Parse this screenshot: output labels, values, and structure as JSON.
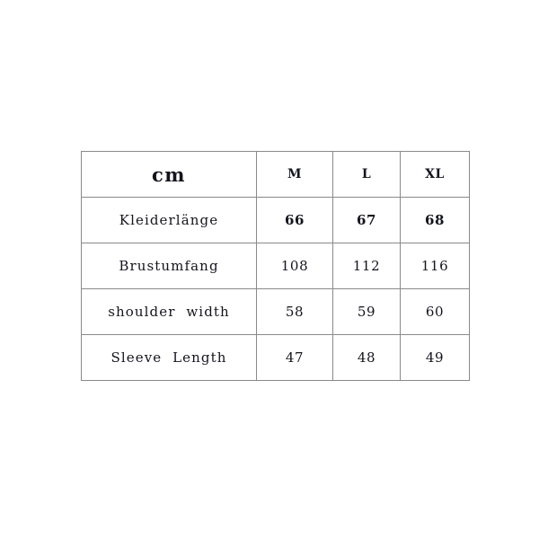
{
  "table": {
    "header": {
      "unit_label": "cm",
      "sizes": [
        "M",
        "L",
        "XL"
      ]
    },
    "rows": [
      {
        "label": "Kleiderlänge",
        "bold_values": true,
        "values": [
          "66",
          "67",
          "68"
        ]
      },
      {
        "label": "Brustumfang",
        "bold_values": false,
        "values": [
          "108",
          "112",
          "116"
        ]
      },
      {
        "label": "shoulder width",
        "bold_values": false,
        "values": [
          "58",
          "59",
          "60"
        ]
      },
      {
        "label": "Sleeve Length",
        "bold_values": false,
        "values": [
          "47",
          "48",
          "49"
        ]
      }
    ]
  },
  "colors": {
    "background": "#ffffff",
    "border": "#8a8a8a",
    "text": "#14141e"
  }
}
